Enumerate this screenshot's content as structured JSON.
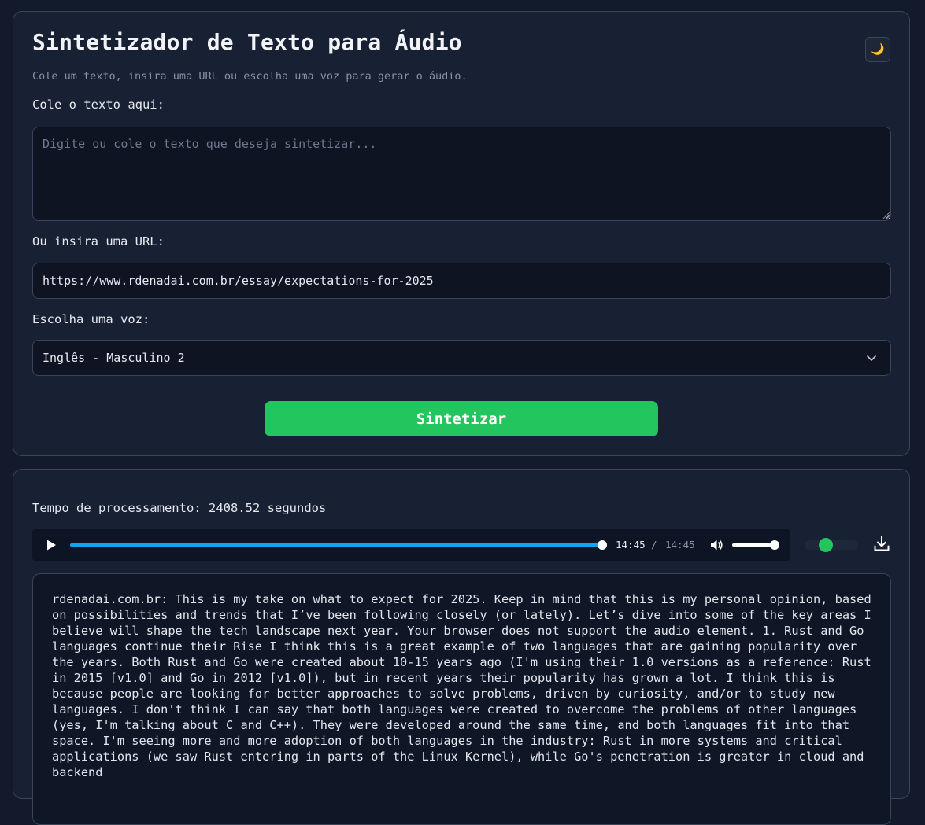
{
  "header": {
    "title": "Sintetizador de Texto para Áudio",
    "subtitle": "Cole um texto, insira uma URL ou escolha uma voz para gerar o áudio.",
    "theme_toggle_icon": "moon-icon"
  },
  "form": {
    "text_label": "Cole o texto aqui:",
    "text_placeholder": "Digite ou cole o texto que deseja sintetizar...",
    "text_value": "",
    "url_label": "Ou insira uma URL:",
    "url_value": "https://www.rdenadai.com.br/essay/expectations-for-2025",
    "voice_label": "Escolha uma voz:",
    "voice_selected": "Inglês - Masculino 2",
    "submit_label": "Sintetizar"
  },
  "result": {
    "processing_label": "Tempo de processamento:",
    "processing_value": "2408.52",
    "processing_unit": "segundos",
    "player": {
      "current_time": "14:45",
      "separator": "/",
      "total_time": "14:45",
      "progress": 1.0,
      "volume": 1.0
    },
    "transcript": "rdenadai.com.br: This is my take on what to expect for 2025. Keep in mind that this is my personal opinion, based on possibilities and trends that I’ve been following closely (or lately). Let’s dive into some of the key areas I believe will shape the tech landscape next year. Your browser does not support the audio element. 1. Rust and Go languages continue their Rise I think this is a great example of two languages that are gaining popularity over the years. Both Rust and Go were created about 10-15 years ago (I'm using their 1.0 versions as a reference: Rust in 2015 [v1.0] and Go in 2012 [v1.0]), but in recent years their popularity has grown a lot. I think this is because people are looking for better approaches to solve problems, driven by curiosity, and/or to study new languages. I don't think I can say that both languages were created to overcome the problems of other languages (yes, I'm talking about C and C++). They were developed around the same time, and both languages fit into that space. I'm seeing more and more adoption of both languages in the industry: Rust in more systems and critical applications (we saw Rust entering in parts of the Linux Kernel), while Go's penetration is greater in cloud and backend"
  },
  "colors": {
    "accent": "#22c55e",
    "progress": "#0ea5e9",
    "background": "#121a2b",
    "card": "#182033"
  }
}
